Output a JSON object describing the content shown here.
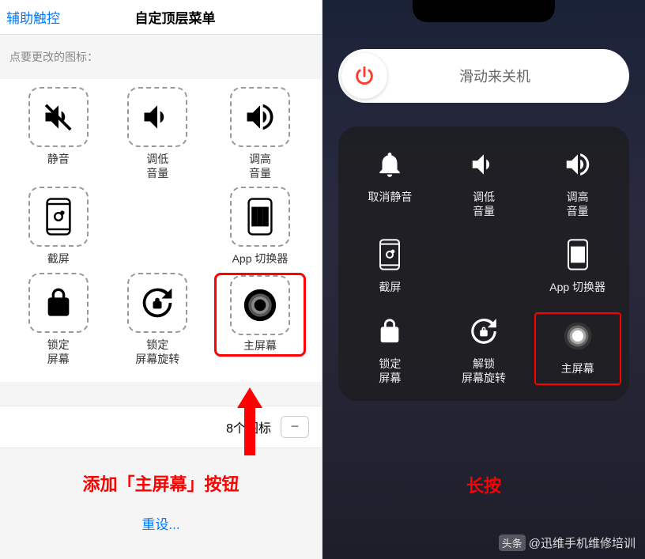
{
  "left": {
    "back": "辅助触控",
    "title": "自定顶层菜单",
    "prompt": "点要更改的图标：",
    "icons": [
      {
        "name": "mute-icon",
        "label": "静音"
      },
      {
        "name": "volume-down-icon",
        "label": "调低\n音量"
      },
      {
        "name": "volume-up-icon",
        "label": "调高\n音量"
      },
      {
        "name": "screenshot-icon",
        "label": "截屏"
      },
      {
        "name": "empty",
        "label": ""
      },
      {
        "name": "app-switcher-icon",
        "label": "App 切换器"
      },
      {
        "name": "lock-screen-icon",
        "label": "锁定\n屏幕"
      },
      {
        "name": "lock-rotate-icon",
        "label": "锁定\n屏幕旋转"
      },
      {
        "name": "home-icon",
        "label": "主屏幕",
        "highlighted": true
      }
    ],
    "counter": "8个图标",
    "minus": "−",
    "annotation": "添加「主屏幕」按钮",
    "reset": "重设..."
  },
  "right": {
    "slider": "滑动来关机",
    "icons": [
      {
        "name": "unmute-icon",
        "label": "取消静音"
      },
      {
        "name": "volume-down-icon",
        "label": "调低\n音量"
      },
      {
        "name": "volume-up-icon",
        "label": "调高\n音量"
      },
      {
        "name": "screenshot-icon",
        "label": "截屏"
      },
      {
        "name": "empty",
        "label": ""
      },
      {
        "name": "app-switcher-icon",
        "label": "App 切换器"
      },
      {
        "name": "lock-screen-icon",
        "label": "锁定\n屏幕"
      },
      {
        "name": "unlock-rotate-icon",
        "label": "解锁\n屏幕旋转"
      },
      {
        "name": "home-icon",
        "label": "主屏幕",
        "highlighted": true
      }
    ],
    "annotation": "长按",
    "watermark_badge": "头条",
    "watermark": "@迅维手机维修培训"
  }
}
